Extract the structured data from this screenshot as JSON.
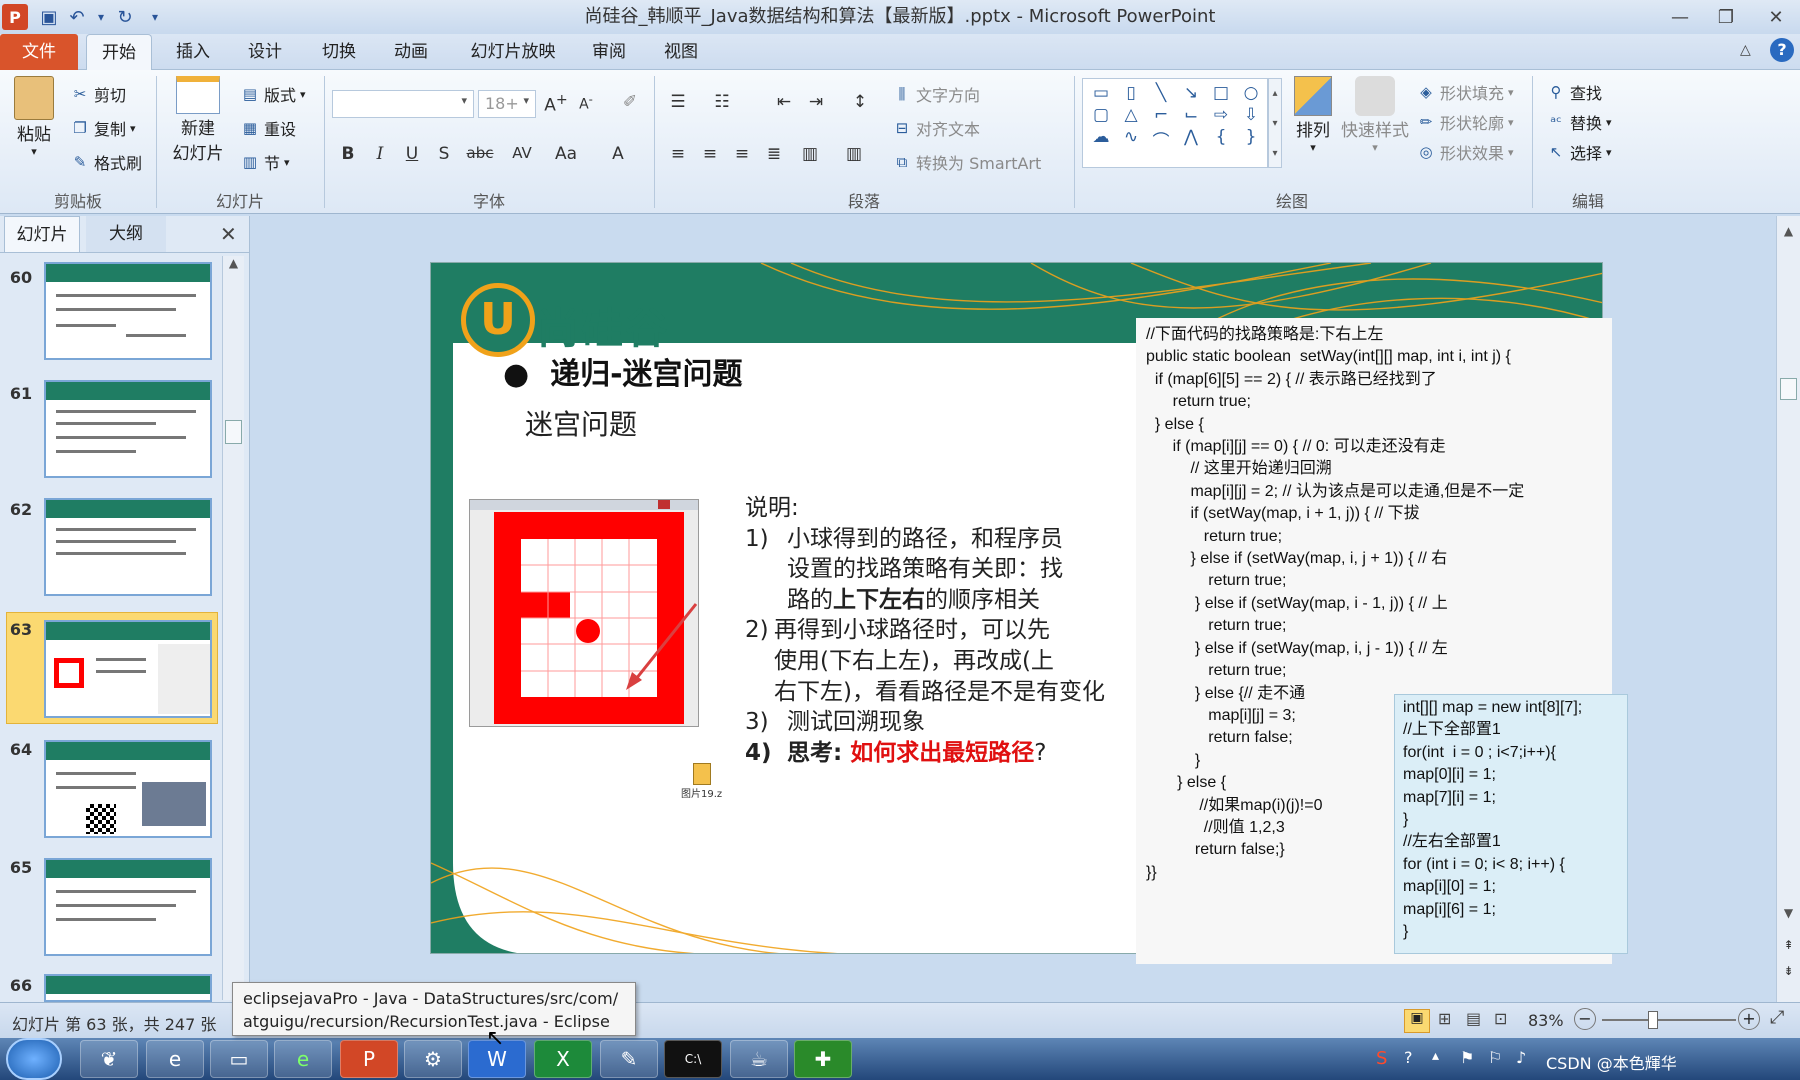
{
  "window": {
    "title": "尚硅谷_韩顺平_Java数据结构和算法【最新版】.pptx - Microsoft PowerPoint"
  },
  "ribbon_tabs": [
    "文件",
    "开始",
    "插入",
    "设计",
    "切换",
    "动画",
    "幻灯片放映",
    "审阅",
    "视图"
  ],
  "clipboard": {
    "paste": "粘贴",
    "cut": "剪切",
    "copy": "复制",
    "format_painter": "格式刷",
    "label": "剪贴板"
  },
  "slides_group": {
    "new_slide_1": "新建",
    "new_slide_2": "幻灯片",
    "layout": "版式",
    "reset": "重设",
    "section": "节",
    "label": "幻灯片"
  },
  "font_group": {
    "font_size": "18+",
    "label": "字体",
    "bold": "B",
    "italic": "I",
    "underline": "U",
    "shadow": "S",
    "strike": "abc",
    "spacing": "AV",
    "case": "Aa",
    "color": "A"
  },
  "paragraph_group": {
    "text_direction": "文字方向",
    "align_text": "对齐文本",
    "smartart": "转换为 SmartArt",
    "label": "段落"
  },
  "drawing_group": {
    "arrange": "排列",
    "quick_styles": "快速样式",
    "shape_fill": "形状填充",
    "shape_outline": "形状轮廓",
    "shape_effects": "形状效果",
    "label": "绘图"
  },
  "editing_group": {
    "find": "查找",
    "replace": "替换",
    "select": "选择",
    "label": "编辑"
  },
  "panel": {
    "tab_slides": "幻灯片",
    "tab_outline": "大纲",
    "slide_numbers": [
      "60",
      "61",
      "62",
      "63",
      "64",
      "65",
      "66"
    ],
    "selected": "63"
  },
  "slide": {
    "logo": "尚硅谷",
    "heading": "递归-迷宫问题",
    "subheading": "迷宫问题",
    "desc_title": "说明:",
    "items": [
      {
        "num": "1)",
        "lines": [
          "小球得到的路径，和程序员",
          "设置的找路策略有关即：找"
        ],
        "line3_pre": "路的",
        "line3_bold": "上下左右",
        "line3_post": "的顺序相关"
      },
      {
        "num": "2)",
        "lines": [
          "再得到小球路径时，可以先",
          "使用(下右上左)，再改成(上",
          "右下左)，看看路径是不是有变化"
        ]
      },
      {
        "num": "3)",
        "lines": [
          "测试回溯现象"
        ]
      }
    ],
    "item4_num": "4)",
    "item4_label": "思考:",
    "item4_red": "如何求出最短路径",
    "item4_end": "?",
    "file_icon_label": "图片19.z",
    "code_main": "//下面代码的找路策略是:下右上左\npublic static boolean  setWay(int[][] map, int i, int j) {\n  if (map[6][5] == 2) { // 表示路已经找到了\n      return true;\n  } else {\n      if (map[i][j] == 0) { // 0: 可以走还没有走\n          // 这里开始递归回溯\n          map[i][j] = 2; // 认为该点是可以走通,但是不一定\n          if (setWay(map, i + 1, j)) { // 下拔\n             return true;\n          } else if (setWay(map, i, j + 1)) { // 右\n              return true;\n           } else if (setWay(map, i - 1, j)) { // 上\n              return true;\n           } else if (setWay(map, i, j - 1)) { // 左\n              return true;\n           } else {// 走不通\n              map[i][j] = 3;\n              return false;\n           }\n       } else {\n            //如果map(i)(j)!=0\n             //则值 1,2,3\n           return false;}\n}}",
    "code_side": "int[][] map = new int[8][7];\n//上下全部置1\nfor(int  i = 0 ; i<7;i++){\nmap[0][i] = 1;\nmap[7][i] = 1;\n}\n//左右全部置1\nfor (int i = 0; i< 8; i++) {\nmap[i][0] = 1;\nmap[i][6] = 1;\n}"
  },
  "status": {
    "slide_info": "幻灯片 第 63 张，共 247 张",
    "zoom": "83%"
  },
  "tooltip": {
    "line1": "eclipsejavaPro - Java - DataStructures/src/com/",
    "line2": "atguigu/recursion/RecursionTest.java - Eclipse"
  },
  "tray": {
    "text": "CSDN @本色輝华"
  },
  "colors": {
    "accent_red": "#ff0000",
    "teal": "#1f7d63",
    "orange": "#f0a21a"
  }
}
